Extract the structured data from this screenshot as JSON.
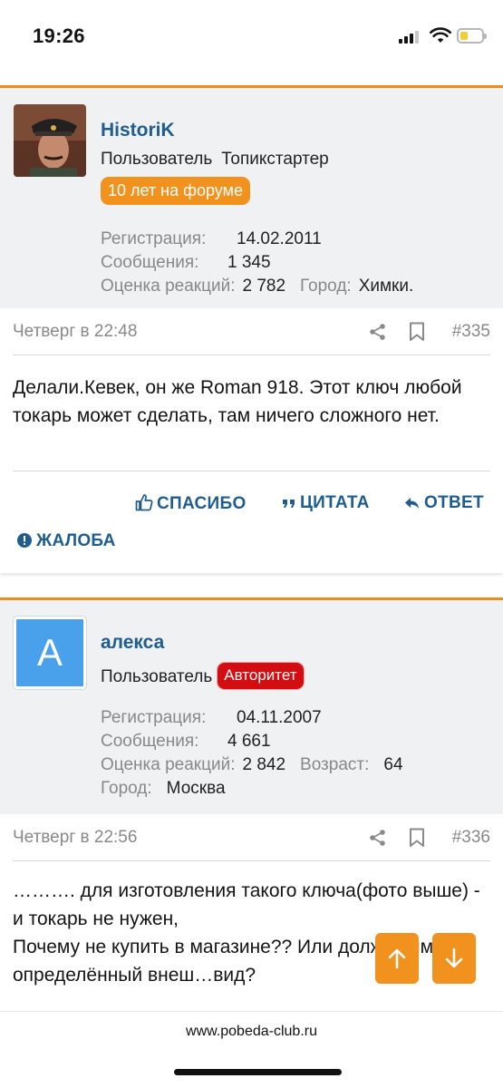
{
  "status_bar": {
    "time": "19:26"
  },
  "posts": [
    {
      "username": "HistoriK",
      "title": "Пользователь",
      "extra_title": "Топикстартер",
      "badge": "10 лет на форуме",
      "stats": {
        "reg_label": "Регистрация:",
        "reg_value": "14.02.2011",
        "msg_label": "Сообщения:",
        "msg_value": "1 345",
        "react_label": "Оценка реакций:",
        "react_value": "2 782",
        "city_label": "Город:",
        "city_value": "Химки."
      },
      "date": "Четверг в 22:48",
      "number": "#335",
      "body": "Делали.Кевек, он же Roman 918. Этот ключ любой токарь может сделать, там ничего сложного нет.",
      "actions": {
        "like": "СПАСИБО",
        "quote": "ЦИТАТА",
        "reply": "ОТВЕТ",
        "report": "ЖАЛОБА"
      }
    },
    {
      "avatar_letter": "А",
      "username": "алекса",
      "title": "Пользователь",
      "badge": "Авторитет",
      "stats": {
        "reg_label": "Регистрация:",
        "reg_value": "04.11.2007",
        "msg_label": "Сообщения:",
        "msg_value": "4 661",
        "react_label": "Оценка реакций:",
        "react_value": "2 842",
        "age_label": "Возраст:",
        "age_value": "64",
        "city_label": "Город:",
        "city_value": "Москва"
      },
      "date": "Четверг в 22:56",
      "number": "#336",
      "body_line1": "………. для изготовления такого ключа(фото выше) - и токарь не нужен,",
      "body_line2": "Почему не купить в магазине?? Или должен иметь определённый внеш…вид?"
    }
  ],
  "browser": {
    "url": "www.pobeda-club.ru"
  }
}
